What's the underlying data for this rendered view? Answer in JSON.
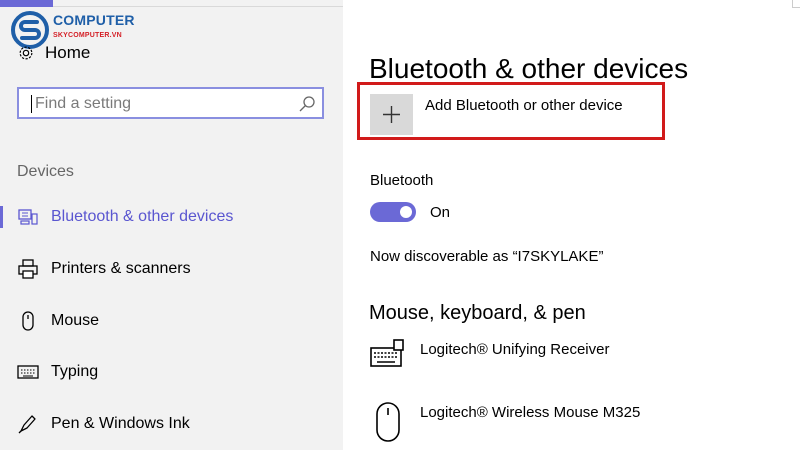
{
  "logo": {
    "line1": "COMPUTER",
    "line2": "SKYCOMPUTER.VN",
    "accent_blue": "#1f5fa8",
    "accent_red": "#d41f26"
  },
  "sidebar": {
    "home_label": "Home",
    "search": {
      "placeholder": "Find a setting"
    },
    "section_label": "Devices",
    "items": [
      {
        "label": "Bluetooth & other devices",
        "icon": "bluetooth-devices-icon",
        "active": true
      },
      {
        "label": "Printers & scanners",
        "icon": "printer-icon",
        "active": false
      },
      {
        "label": "Mouse",
        "icon": "mouse-icon",
        "active": false
      },
      {
        "label": "Typing",
        "icon": "keyboard-icon",
        "active": false
      },
      {
        "label": "Pen & Windows Ink",
        "icon": "pen-icon",
        "active": false
      }
    ]
  },
  "main": {
    "title": "Bluetooth & other devices",
    "add_device_label": "Add Bluetooth or other device",
    "bluetooth_heading": "Bluetooth",
    "toggle_state": "On",
    "discoverable_text": "Now discoverable as “I7SKYLAKE”",
    "section_heading": "Mouse, keyboard, & pen",
    "devices": [
      {
        "label": "Logitech® Unifying Receiver",
        "icon": "keyboard-icon"
      },
      {
        "label": "Logitech® Wireless Mouse M325",
        "icon": "mouse-icon"
      }
    ]
  },
  "colors": {
    "accent": "#6b69d6",
    "highlight_border": "#d11a1a",
    "sidebar_bg": "#f2f2f2"
  }
}
